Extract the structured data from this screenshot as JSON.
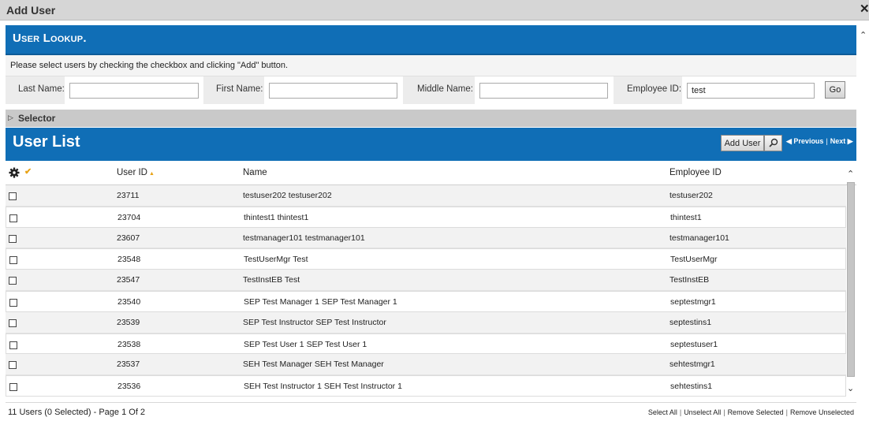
{
  "window": {
    "title": "Add User",
    "close_label": "✕"
  },
  "lookup": {
    "heading": "User Lookup.",
    "instructions": "Please select users by checking the checkbox and clicking \"Add\" button.",
    "fields": {
      "last_name_label": "Last Name:",
      "last_name_value": "",
      "first_name_label": "First Name:",
      "first_name_value": "",
      "middle_name_label": "Middle Name:",
      "middle_name_value": "",
      "employee_id_label": "Employee ID:",
      "employee_id_value": "test"
    },
    "go_label": "Go"
  },
  "selector": {
    "label": "Selector"
  },
  "user_list": {
    "heading": "User List",
    "add_button_label": "Add User",
    "pager": {
      "previous": "◀ Previous",
      "separator": "|",
      "next": "Next ▶"
    },
    "columns": {
      "user_id": "User ID",
      "name": "Name",
      "employee_id": "Employee ID",
      "check_icon": "✔",
      "sort_icon": "▲"
    },
    "rows": [
      {
        "user_id": "23711",
        "name": "testuser202 testuser202",
        "employee_id": "testuser202"
      },
      {
        "user_id": "23704",
        "name": "thintest1 thintest1",
        "employee_id": "thintest1"
      },
      {
        "user_id": "23607",
        "name": "testmanager101 testmanager101",
        "employee_id": "testmanager101"
      },
      {
        "user_id": "23548",
        "name": "TestUserMgr Test",
        "employee_id": "TestUserMgr"
      },
      {
        "user_id": "23547",
        "name": "TestInstEB Test",
        "employee_id": "TestInstEB"
      },
      {
        "user_id": "23540",
        "name": "SEP Test Manager 1 SEP Test Manager 1",
        "employee_id": "septestmgr1"
      },
      {
        "user_id": "23539",
        "name": "SEP Test Instructor SEP Test Instructor",
        "employee_id": "septestins1"
      },
      {
        "user_id": "23538",
        "name": "SEP Test User 1 SEP Test User 1",
        "employee_id": "septestuser1"
      },
      {
        "user_id": "23537",
        "name": "SEH Test Manager SEH Test Manager",
        "employee_id": "sehtestmgr1"
      },
      {
        "user_id": "23536",
        "name": "SEH Test Instructor 1 SEH Test Instructor 1",
        "employee_id": "sehtestins1"
      }
    ]
  },
  "footer": {
    "count_text": "11 Users (0 Selected) - Page 1 Of 2",
    "select_all": "Select All",
    "unselect_all": "Unselect All",
    "remove_selected": "Remove Selected",
    "remove_unselected": "Remove Unselected",
    "separator": "|"
  },
  "icons": {
    "scroll_up": "⌃",
    "scroll_down": "⌄",
    "expand": "▷"
  },
  "colors": {
    "header_blue": "#106eb6",
    "accent_orange": "#e8a317"
  }
}
